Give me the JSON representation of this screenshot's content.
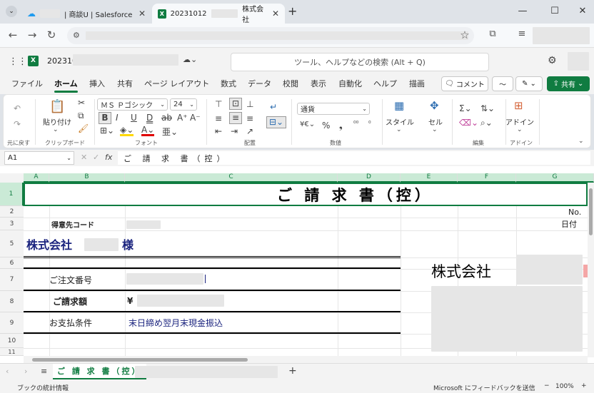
{
  "browser": {
    "tabs": [
      {
        "label": "| 商談U | Salesforce"
      },
      {
        "label": "20231012",
        "label_suffix": "株式会社"
      }
    ],
    "new_tab": "+"
  },
  "excel": {
    "file_name": "202310",
    "search_placeholder": "ツール、ヘルプなどの検索 (Alt + Q)",
    "menu": [
      "ファイル",
      "ホーム",
      "挿入",
      "共有",
      "ページ レイアウト",
      "数式",
      "データ",
      "校閲",
      "表示",
      "自動化",
      "ヘルプ",
      "描画"
    ],
    "active_menu": "ホーム",
    "comment_btn": "コメント",
    "share_btn": "共有",
    "ribbon": {
      "undo_group": "元に戻す",
      "paste_label": "貼り付け",
      "clipboard_group": "クリップボード",
      "font_name": "ＭＳ Ｐゴシック",
      "font_size": "24",
      "font_group": "フォント",
      "align_group": "配置",
      "number_format": "通貨",
      "number_group": "数値",
      "style_label": "スタイル",
      "cell_label": "セル",
      "edit_group": "編集",
      "addin_label": "アドイン",
      "addin_group": "アドイン"
    },
    "name_box": "A1",
    "formula_text": "ご 請 求 書（控）",
    "columns": [
      "A",
      "B",
      "C",
      "D",
      "E",
      "F",
      "G"
    ],
    "rows": [
      "1",
      "2",
      "3",
      "5",
      "6",
      "7",
      "8",
      "9",
      "10",
      "11"
    ],
    "sheet": {
      "title": "ご 請 求 書（控）",
      "no_label": "No.",
      "date_label": "日付",
      "customer_code_label": "得意先コード",
      "company_prefix": "株式会社",
      "honorific": "様",
      "order_no_label": "ご注文番号",
      "billing_amount_label": "ご請求額",
      "yen_mark": "¥",
      "payment_terms_label": "お支払条件",
      "payment_terms_value": "末日締め翌月末現金振込",
      "issuer_company": "株式会社"
    },
    "sheet_tab": "ご 請 求 書（控）",
    "status_left": "ブックの統計情報",
    "feedback": "Microsoft にフィードバックを送信",
    "zoom": "100%"
  }
}
